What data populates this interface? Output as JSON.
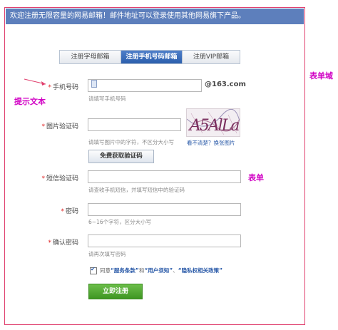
{
  "banner": {
    "text": "欢迎注册无限容量的网易邮箱！邮件地址可以登录使用其他网易旗下产品。"
  },
  "tabs": [
    {
      "label": "注册字母邮箱",
      "active": false
    },
    {
      "label": "注册手机号码邮箱",
      "active": true
    },
    {
      "label": "注册VIP邮箱",
      "active": false
    }
  ],
  "form": {
    "phone": {
      "label": "手机号码",
      "hint": "请填写手机号码",
      "suffix": "@163.com"
    },
    "captcha": {
      "label": "图片验证码",
      "hint": "请填写图片中的字符，不区分大小写",
      "image_text": "A5AlLa",
      "refresh_link": "看不清楚？换张图片",
      "sms_button": "免费获取验证码"
    },
    "sms_code": {
      "label": "短信验证码",
      "hint": "请查收手机短信，并填写短信中的验证码"
    },
    "password": {
      "label": "密码",
      "hint": "6~16个字符，区分大小写"
    },
    "confirm_password": {
      "label": "确认密码",
      "hint": "请再次填写密码"
    },
    "required_mark": "*",
    "agreement": {
      "prefix": "同意",
      "link1": "“服务条款”",
      "and": "和",
      "link2": "“用户须知”",
      "sep": "、",
      "link3": "“隐私权相关政策”",
      "checked": true
    },
    "submit": "立即注册"
  },
  "annotations": {
    "form_area": "表单域",
    "hint_text": "提示文本",
    "form": "表单"
  },
  "colors": {
    "banner": "#5d7fbc",
    "annotation": "#d100c4",
    "frame": "#e0406e",
    "submit": "#4aa42c",
    "tab_active": "#2b5fad"
  }
}
